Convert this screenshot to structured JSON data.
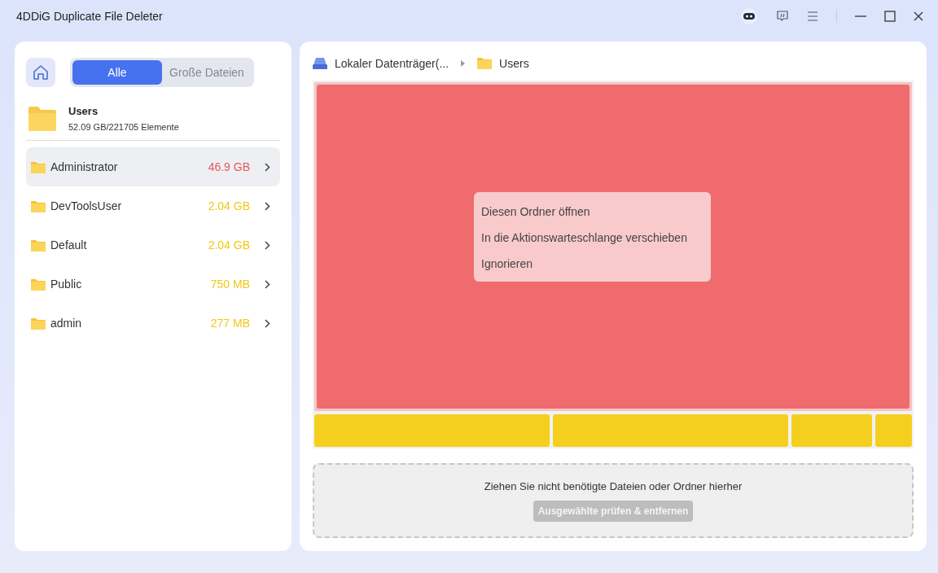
{
  "window": {
    "title": "4DDiG Duplicate File Deleter"
  },
  "tabs": [
    {
      "label": "Alle",
      "selected": true
    },
    {
      "label": "Große Dateien",
      "selected": false
    }
  ],
  "folder": {
    "name": "Users",
    "info": "52.09 GB/221705 Elemente"
  },
  "sidebar": {
    "items": [
      {
        "name": "Administrator",
        "size": "46.9 GB",
        "color": "#e5575c",
        "selected": true
      },
      {
        "name": "DevToolsUser",
        "size": "2.04 GB",
        "color": "#f2c811",
        "selected": false
      },
      {
        "name": "Default",
        "size": "2.04 GB",
        "color": "#f2c811",
        "selected": false
      },
      {
        "name": "Public",
        "size": "750 MB",
        "color": "#f2c811",
        "selected": false
      },
      {
        "name": "admin",
        "size": "277 MB",
        "color": "#f2c811",
        "selected": false
      }
    ]
  },
  "breadcrumb": [
    {
      "kind": "drive",
      "label": "Lokaler Datenträger(..."
    },
    {
      "kind": "folder",
      "label": "Users"
    }
  ],
  "treemap": {
    "rows": [
      [
        {
          "color": "#ef6b6e"
        }
      ],
      [
        {
          "color": "#f5cf1e"
        },
        {
          "color": "#f5cf1e"
        },
        {
          "color": "#f5cf1e"
        },
        {
          "color": "#f5cf1e"
        }
      ]
    ]
  },
  "context_menu": [
    "Diesen Ordner öffnen",
    "In die Aktionswarteschlange verschieben",
    "Ignorieren"
  ],
  "drop_zone": {
    "hint": "Ziehen Sie nicht benötigte Dateien oder Ordner hierher",
    "button": "Ausgewählte prüfen & entfernen",
    "disabled": true
  }
}
